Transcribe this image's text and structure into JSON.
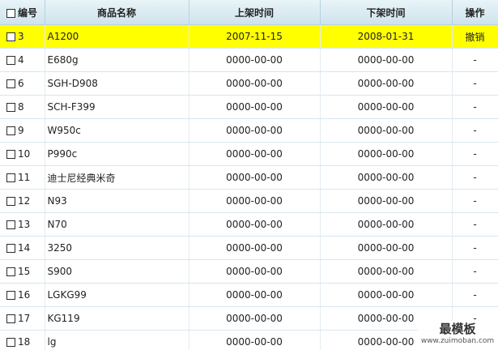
{
  "table": {
    "headers": {
      "id": "编号",
      "name": "商品名称",
      "list_time": "上架时间",
      "delist_time": "下架时间",
      "action": "操作"
    },
    "highlight_color": "#ffff00",
    "rows": [
      {
        "id": "3",
        "name": "A1200",
        "list_time": "2007-11-15",
        "delist_time": "2008-01-31",
        "action": "撤销"
      },
      {
        "id": "4",
        "name": "E680g",
        "list_time": "0000-00-00",
        "delist_time": "0000-00-00",
        "action": "-"
      },
      {
        "id": "6",
        "name": "SGH-D908",
        "list_time": "0000-00-00",
        "delist_time": "0000-00-00",
        "action": "-"
      },
      {
        "id": "8",
        "name": "SCH-F399",
        "list_time": "0000-00-00",
        "delist_time": "0000-00-00",
        "action": "-"
      },
      {
        "id": "9",
        "name": "W950c",
        "list_time": "0000-00-00",
        "delist_time": "0000-00-00",
        "action": "-"
      },
      {
        "id": "10",
        "name": "P990c",
        "list_time": "0000-00-00",
        "delist_time": "0000-00-00",
        "action": "-"
      },
      {
        "id": "11",
        "name": "迪士尼经典米奇",
        "list_time": "0000-00-00",
        "delist_time": "0000-00-00",
        "action": "-"
      },
      {
        "id": "12",
        "name": "N93",
        "list_time": "0000-00-00",
        "delist_time": "0000-00-00",
        "action": "-"
      },
      {
        "id": "13",
        "name": "N70",
        "list_time": "0000-00-00",
        "delist_time": "0000-00-00",
        "action": "-"
      },
      {
        "id": "14",
        "name": "3250",
        "list_time": "0000-00-00",
        "delist_time": "0000-00-00",
        "action": "-"
      },
      {
        "id": "15",
        "name": "S900",
        "list_time": "0000-00-00",
        "delist_time": "0000-00-00",
        "action": "-"
      },
      {
        "id": "16",
        "name": "LGKG99",
        "list_time": "0000-00-00",
        "delist_time": "0000-00-00",
        "action": "-"
      },
      {
        "id": "17",
        "name": "KG119",
        "list_time": "0000-00-00",
        "delist_time": "0000-00-00",
        "action": "-"
      },
      {
        "id": "18",
        "name": "lg",
        "list_time": "0000-00-00",
        "delist_time": "0000-00-00",
        "action": "-"
      }
    ]
  },
  "watermark": {
    "title": "最模板",
    "url": "www.zuimoban.com"
  }
}
